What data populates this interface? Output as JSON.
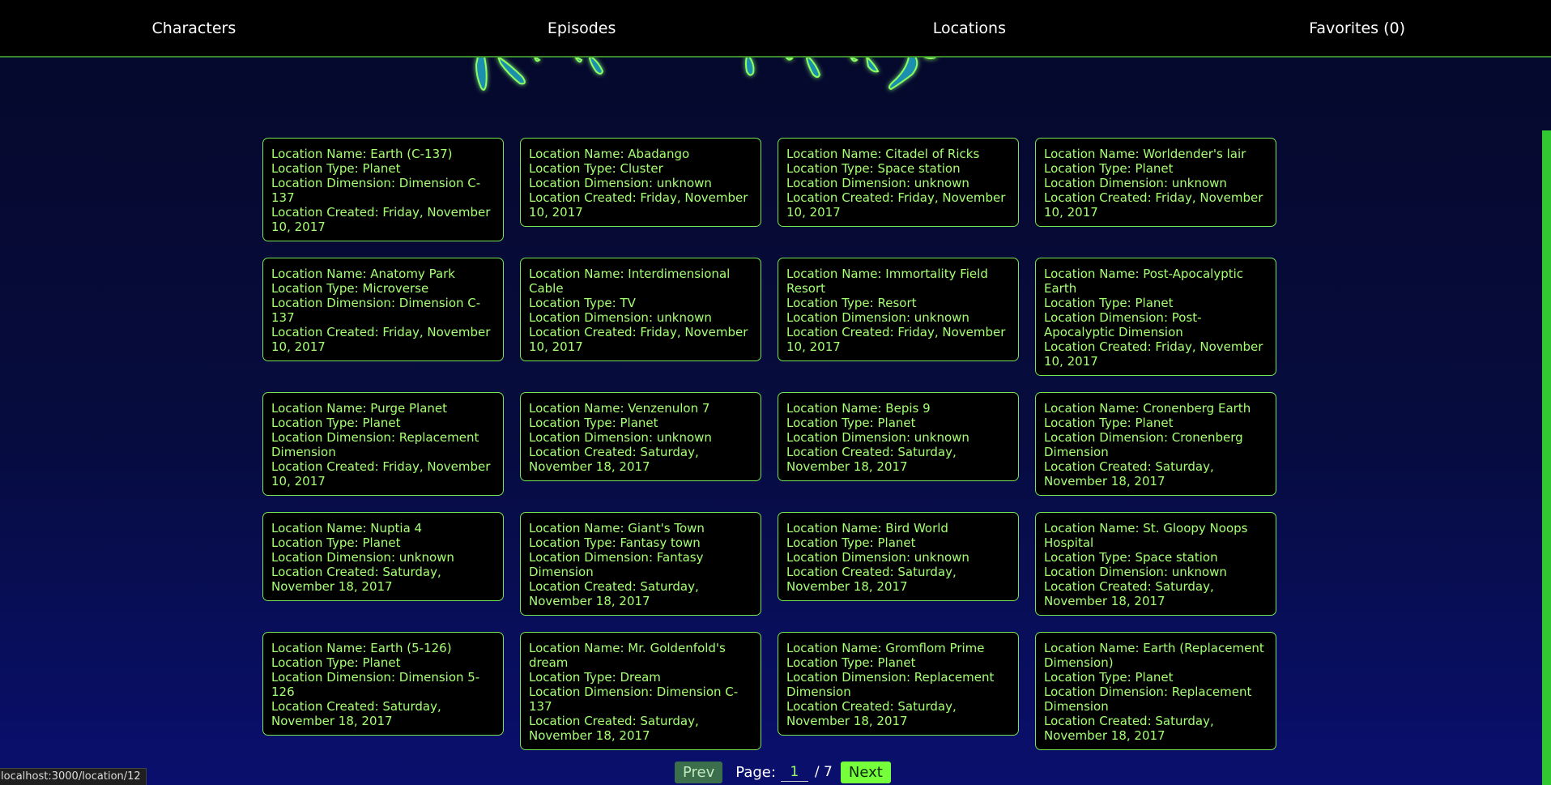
{
  "nav": {
    "characters": "Characters",
    "episodes": "Episodes",
    "locations": "Locations",
    "favorites": "Favorites (0)"
  },
  "labels": {
    "name": "Location Name: ",
    "type": "Location Type: ",
    "dimension": "Location Dimension: ",
    "created": "Location Created: "
  },
  "locations": [
    {
      "name": "Earth (C-137)",
      "type": "Planet",
      "dimension": "Dimension C-137",
      "created": "Friday, November 10, 2017"
    },
    {
      "name": "Abadango",
      "type": "Cluster",
      "dimension": "unknown",
      "created": "Friday, November 10, 2017"
    },
    {
      "name": "Citadel of Ricks",
      "type": "Space station",
      "dimension": "unknown",
      "created": "Friday, November 10, 2017"
    },
    {
      "name": "Worldender's lair",
      "type": "Planet",
      "dimension": "unknown",
      "created": "Friday, November 10, 2017"
    },
    {
      "name": "Anatomy Park",
      "type": "Microverse",
      "dimension": "Dimension C-137",
      "created": "Friday, November 10, 2017"
    },
    {
      "name": "Interdimensional Cable",
      "type": "TV",
      "dimension": "unknown",
      "created": "Friday, November 10, 2017"
    },
    {
      "name": "Immortality Field Resort",
      "type": "Resort",
      "dimension": "unknown",
      "created": "Friday, November 10, 2017"
    },
    {
      "name": "Post-Apocalyptic Earth",
      "type": "Planet",
      "dimension": "Post-Apocalyptic Dimension",
      "created": "Friday, November 10, 2017"
    },
    {
      "name": "Purge Planet",
      "type": "Planet",
      "dimension": "Replacement Dimension",
      "created": "Friday, November 10, 2017"
    },
    {
      "name": "Venzenulon 7",
      "type": "Planet",
      "dimension": "unknown",
      "created": "Saturday, November 18, 2017"
    },
    {
      "name": "Bepis 9",
      "type": "Planet",
      "dimension": "unknown",
      "created": "Saturday, November 18, 2017"
    },
    {
      "name": "Cronenberg Earth",
      "type": "Planet",
      "dimension": "Cronenberg Dimension",
      "created": "Saturday, November 18, 2017"
    },
    {
      "name": "Nuptia 4",
      "type": "Planet",
      "dimension": "unknown",
      "created": "Saturday, November 18, 2017"
    },
    {
      "name": "Giant's Town",
      "type": "Fantasy town",
      "dimension": "Fantasy Dimension",
      "created": "Saturday, November 18, 2017"
    },
    {
      "name": "Bird World",
      "type": "Planet",
      "dimension": "unknown",
      "created": "Saturday, November 18, 2017"
    },
    {
      "name": "St. Gloopy Noops Hospital",
      "type": "Space station",
      "dimension": "unknown",
      "created": "Saturday, November 18, 2017"
    },
    {
      "name": "Earth (5-126)",
      "type": "Planet",
      "dimension": "Dimension 5-126",
      "created": "Saturday, November 18, 2017"
    },
    {
      "name": "Mr. Goldenfold's dream",
      "type": "Dream",
      "dimension": "Dimension C-137",
      "created": "Saturday, November 18, 2017"
    },
    {
      "name": "Gromflom Prime",
      "type": "Planet",
      "dimension": "Replacement Dimension",
      "created": "Saturday, November 18, 2017"
    },
    {
      "name": "Earth (Replacement Dimension)",
      "type": "Planet",
      "dimension": "Replacement Dimension",
      "created": "Saturday, November 18, 2017"
    }
  ],
  "pagination": {
    "prev": "Prev",
    "page_label": "Page:",
    "current": "1",
    "total": "/ 7",
    "next": "Next"
  },
  "status_url": "localhost:3000/location/12",
  "colors": {
    "accent": "#76e552",
    "card_text": "#a6ff73",
    "background": "#060c3e"
  },
  "icons": {
    "logo": "portal-drip-logo"
  }
}
